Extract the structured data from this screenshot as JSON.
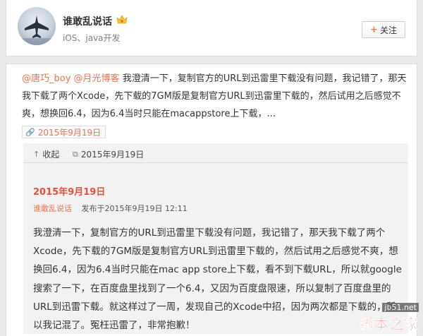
{
  "profile": {
    "name": "谁敢乱说话",
    "bio": "iOS、java开发",
    "avatar": "fighter-jet-avatar",
    "follow_plus": "+",
    "follow_label": "关注"
  },
  "post": {
    "mention1": "@唐巧_boy",
    "mention2": "@月光博客",
    "text": " 我澄清一下，复制官方的URL到迅雷里下载没有问题，我记错了，那天我下载了两个Xcode，先下载的7GM版是复制官方URL到迅雷里下载的，然后试用之后感觉不爽，想换回6.4，因为6.4当时只能在macappstore上下载，...",
    "time": "2015年9月19日"
  },
  "article": {
    "collect_label": "收起",
    "bar_date": "2015年9月19日",
    "date": "2015年9月19日",
    "author": "谁敢乱说话",
    "published": "发布于2015年9月19日 12:11",
    "body": "我澄清一下，复制官方的URL到迅雷里下载没有问题，我记错了，那天我下载了两个Xcode，先下载的7GM版是复制官方URL到迅雷里下载的，然后试用之后感觉不爽，想换回6.4，因为6.4当时只能在mac app store上下载，看不到下载URL，所以就google搜索了一下，在百度盘里找到了一个6.4，又因为百度盘限速，所以复制了百度盘里的URL到迅雷下载。就这样过了一周，发现自己的Xcode中招，因为两次都是下载的，所以我记混了。冤枉迅雷了，非常抱歉！"
  },
  "watermark": {
    "url": "jb51.net",
    "name": "脚本之家"
  },
  "colors": {
    "accent": "#eb7350",
    "date_red": "#e2523a",
    "follow_plus": "#ff8140"
  }
}
